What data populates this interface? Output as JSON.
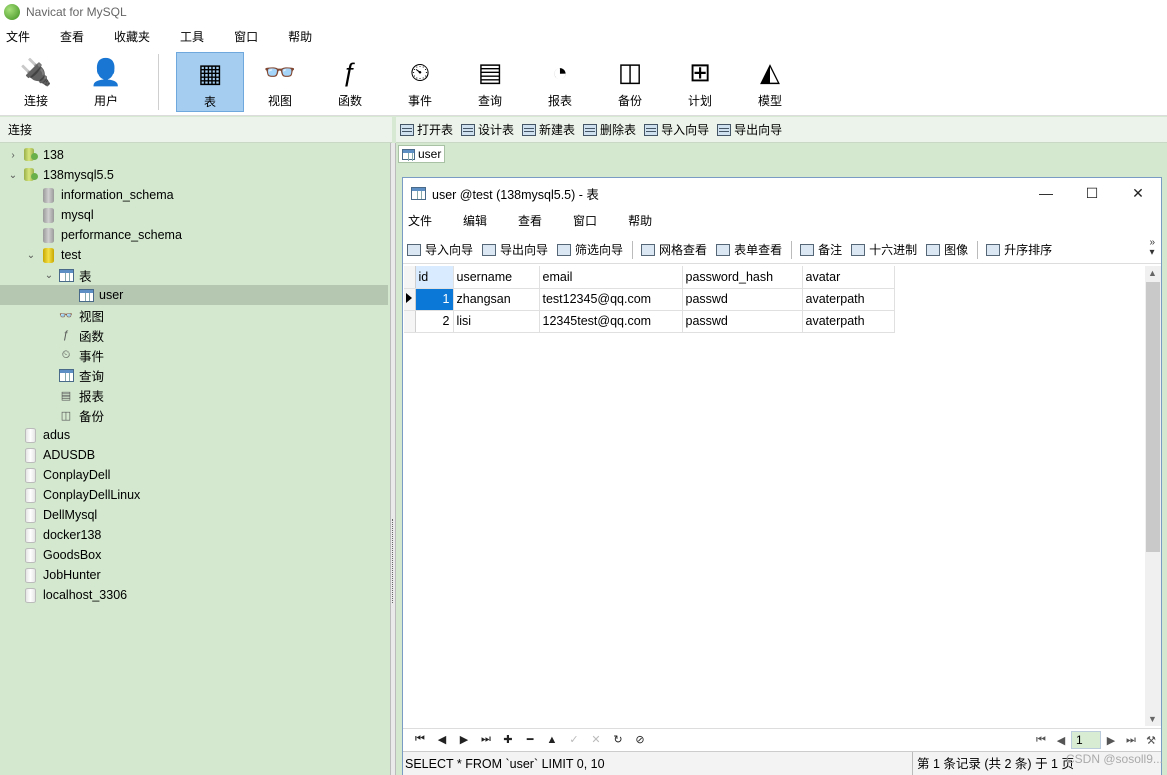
{
  "app": {
    "title": "Navicat for MySQL"
  },
  "menu": [
    "文件",
    "查看",
    "收藏夹",
    "工具",
    "窗口",
    "帮助"
  ],
  "toolbar": [
    {
      "label": "连接",
      "icon": "connection-icon"
    },
    {
      "label": "用户",
      "icon": "user-icon"
    },
    {
      "label": "表",
      "icon": "table-icon",
      "active": true
    },
    {
      "label": "视图",
      "icon": "view-icon"
    },
    {
      "label": "函数",
      "icon": "function-icon"
    },
    {
      "label": "事件",
      "icon": "event-icon"
    },
    {
      "label": "查询",
      "icon": "query-icon"
    },
    {
      "label": "报表",
      "icon": "report-icon"
    },
    {
      "label": "备份",
      "icon": "backup-icon"
    },
    {
      "label": "计划",
      "icon": "schedule-icon"
    },
    {
      "label": "模型",
      "icon": "model-icon"
    }
  ],
  "connections_header": "连接",
  "object_toolbar": [
    "打开表",
    "设计表",
    "新建表",
    "删除表",
    "导入向导",
    "导出向导"
  ],
  "tree": [
    {
      "label": "138",
      "level": 0,
      "arrow": "›",
      "icon": "server"
    },
    {
      "label": "138mysql5.5",
      "level": 0,
      "arrow": "⌄",
      "icon": "server"
    },
    {
      "label": "information_schema",
      "level": 1,
      "icon": "db"
    },
    {
      "label": "mysql",
      "level": 1,
      "icon": "db"
    },
    {
      "label": "performance_schema",
      "level": 1,
      "icon": "db"
    },
    {
      "label": "test",
      "level": 1,
      "arrow": "⌄",
      "icon": "db-open"
    },
    {
      "label": "表",
      "level": 2,
      "arrow": "⌄",
      "icon": "table"
    },
    {
      "label": "user",
      "level": 3,
      "icon": "table",
      "selected": true
    },
    {
      "label": "视图",
      "level": 2,
      "icon": "glyph",
      "glyph": "👓"
    },
    {
      "label": "函数",
      "level": 2,
      "icon": "glyph",
      "glyph": "ƒ"
    },
    {
      "label": "事件",
      "level": 2,
      "icon": "glyph",
      "glyph": "⏲"
    },
    {
      "label": "查询",
      "level": 2,
      "icon": "table"
    },
    {
      "label": "报表",
      "level": 2,
      "icon": "glyph",
      "glyph": "▤"
    },
    {
      "label": "备份",
      "level": 2,
      "icon": "glyph",
      "glyph": "◫"
    },
    {
      "label": "adus",
      "level": 0,
      "icon": "conn"
    },
    {
      "label": "ADUSDB",
      "level": 0,
      "icon": "conn"
    },
    {
      "label": "ConplayDell",
      "level": 0,
      "icon": "conn"
    },
    {
      "label": "ConplayDellLinux",
      "level": 0,
      "icon": "conn"
    },
    {
      "label": "DellMysql",
      "level": 0,
      "icon": "conn"
    },
    {
      "label": "docker138",
      "level": 0,
      "icon": "conn"
    },
    {
      "label": "GoodsBox",
      "level": 0,
      "icon": "conn"
    },
    {
      "label": "JobHunter",
      "level": 0,
      "icon": "conn"
    },
    {
      "label": "localhost_3306",
      "level": 0,
      "icon": "conn"
    }
  ],
  "doc_tab": "user",
  "window": {
    "title": "user @test (138mysql5.5) - 表",
    "minimize": "—",
    "maximize": "☐",
    "close": "✕",
    "menu": [
      "文件",
      "编辑",
      "查看",
      "窗口",
      "帮助"
    ],
    "toolbar_group1": [
      "导入向导",
      "导出向导",
      "筛选向导"
    ],
    "toolbar_group2": [
      "网格查看",
      "表单查看"
    ],
    "toolbar_group3": [
      "备注",
      "十六进制",
      "图像"
    ],
    "toolbar_group4": [
      "升序排序"
    ]
  },
  "grid": {
    "columns": [
      "id",
      "username",
      "email",
      "password_hash",
      "avatar"
    ],
    "rows": [
      [
        "1",
        "zhangsan",
        "test12345@qq.com",
        "passwd",
        "avaterpath"
      ],
      [
        "2",
        "lisi",
        "12345test@qq.com",
        "passwd",
        "avaterpath"
      ]
    ]
  },
  "pager": {
    "page": "1"
  },
  "status": {
    "sql": "SELECT * FROM `user` LIMIT 0, 10",
    "records": "第 1 条记录 (共 2 条) 于 1 页"
  },
  "watermark": "CSDN @sosoll9..."
}
